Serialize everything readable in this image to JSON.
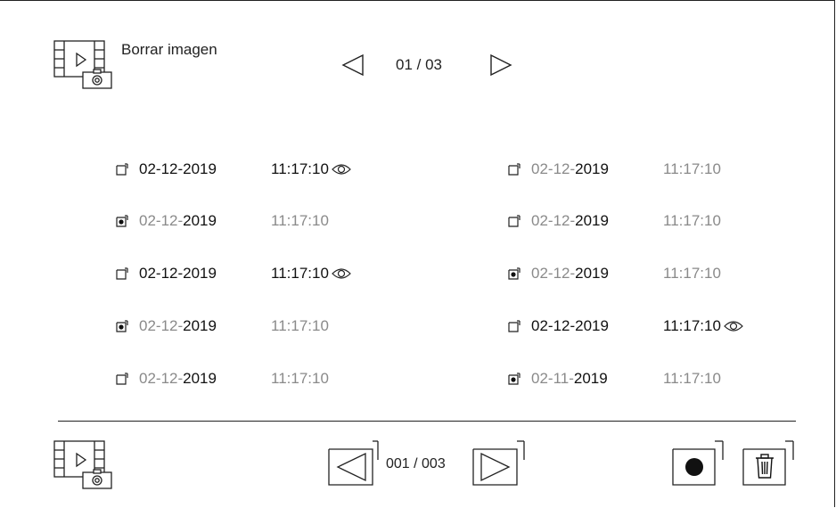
{
  "colors": {
    "text": "#111111",
    "muted": "#8a8a8a",
    "line": "#222222",
    "background": "#ffffff"
  },
  "header": {
    "icon": "gallery-photo-icon",
    "title": "Borrar imagen",
    "pager": {
      "prev_icon": "triangle-left-icon",
      "text": "01 / 03",
      "next_icon": "triangle-right-icon"
    }
  },
  "entries": {
    "left": [
      {
        "checked": false,
        "date_prefix": "02-12-",
        "date_year": "2019",
        "time": "11:17:10",
        "unread": true
      },
      {
        "checked": true,
        "date_prefix": "02-12-",
        "date_year": "2019",
        "time": "11:17:10",
        "unread": false
      },
      {
        "checked": false,
        "date_prefix": "02-12-",
        "date_year": "2019",
        "time": "11:17:10",
        "unread": true
      },
      {
        "checked": true,
        "date_prefix": "02-12-",
        "date_year": "2019",
        "time": "11:17:10",
        "unread": false
      },
      {
        "checked": false,
        "date_prefix": "02-12-",
        "date_year": "2019",
        "time": "11:17:10",
        "unread": false
      }
    ],
    "right": [
      {
        "checked": false,
        "date_prefix": "02-12-",
        "date_year": "2019",
        "time": "11:17:10",
        "unread": false
      },
      {
        "checked": false,
        "date_prefix": "02-12-",
        "date_year": "2019",
        "time": "11:17:10",
        "unread": false
      },
      {
        "checked": true,
        "date_prefix": "02-12-",
        "date_year": "2019",
        "time": "11:17:10",
        "unread": false
      },
      {
        "checked": false,
        "date_prefix": "02-12-",
        "date_year": "2019",
        "time": "11:17:10",
        "unread": true
      },
      {
        "checked": true,
        "date_prefix": "02-11-",
        "date_year": "2019",
        "time": "11:17:10",
        "unread": false
      }
    ]
  },
  "footer": {
    "icon": "gallery-photo-icon",
    "prev_icon": "triangle-left-icon",
    "counter": "001 / 003",
    "next_icon": "triangle-right-icon",
    "record_icon": "record-dot-icon",
    "delete_icon": "trash-icon"
  }
}
